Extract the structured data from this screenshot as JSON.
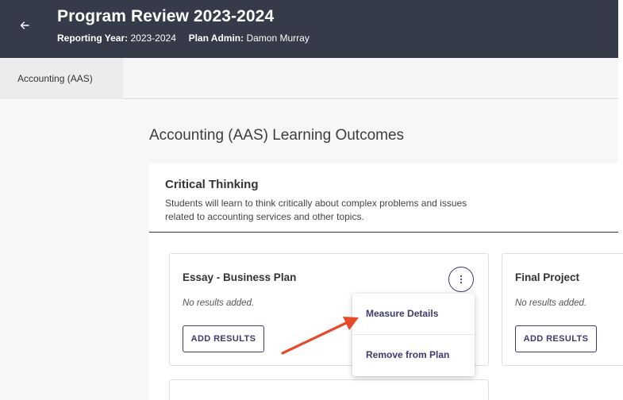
{
  "header": {
    "title": "Program Review 2023-2024",
    "reporting_year_label": "Reporting Year:",
    "reporting_year_value": "2023-2024",
    "plan_admin_label": "Plan Admin:",
    "plan_admin_value": "Damon Murray",
    "back_icon": "arrow-left-icon"
  },
  "subnav": {
    "active_tab": "Accounting (AAS)"
  },
  "main": {
    "page_title": "Accounting (AAS) Learning Outcomes",
    "outcome": {
      "title": "Critical Thinking",
      "description": "Students will learn to think critically about complex problems and issues related to accounting services and other topics."
    },
    "measures": [
      {
        "title": "Essay - Business Plan",
        "status": "No results added.",
        "button": "ADD RESULTS"
      },
      {
        "title": "Final Project",
        "status": "No results added.",
        "button": "ADD RESULTS"
      }
    ],
    "measure_menu": {
      "kebab_icon": "more-vertical-icon",
      "items": [
        "Measure Details",
        "Remove from Plan"
      ]
    }
  },
  "annotation": {
    "arrow_color": "#e8492a",
    "icon": "arrow-annotation-icon"
  },
  "colors": {
    "header_bg": "#353b48",
    "accent": "#3d3a6e",
    "annotation": "#e8492a"
  }
}
